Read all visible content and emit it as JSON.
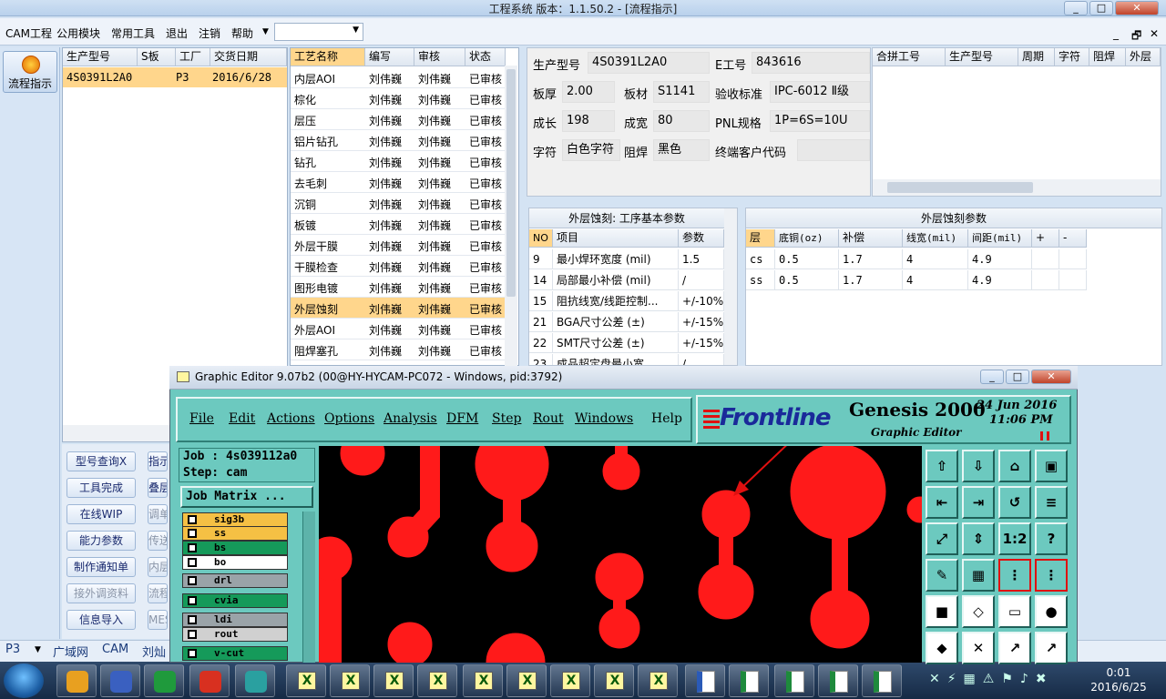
{
  "window": {
    "title": "工程系统  版本：1.1.50.2 - [流程指示]"
  },
  "menu": [
    "CAM工程",
    "公用模块",
    "常用工具",
    "退出",
    "注销",
    "帮助"
  ],
  "mdi_controls": [
    "_",
    "🗗",
    "✕"
  ],
  "sidebar": {
    "flow_button": "流程指示"
  },
  "job_grid": {
    "headers": [
      "生产型号",
      "S板",
      "工厂",
      "交货日期"
    ],
    "rows": [
      [
        "4S0391L2A0",
        "",
        "P3",
        "2016/6/28"
      ]
    ]
  },
  "process_grid": {
    "headers": [
      "工艺名称",
      "编写",
      "审核",
      "状态"
    ],
    "rows": [
      [
        "内层AOI",
        "刘伟巍",
        "刘伟巍",
        "已审核"
      ],
      [
        "棕化",
        "刘伟巍",
        "刘伟巍",
        "已审核"
      ],
      [
        "层压",
        "刘伟巍",
        "刘伟巍",
        "已审核"
      ],
      [
        "铝片钻孔",
        "刘伟巍",
        "刘伟巍",
        "已审核"
      ],
      [
        "钻孔",
        "刘伟巍",
        "刘伟巍",
        "已审核"
      ],
      [
        "去毛刺",
        "刘伟巍",
        "刘伟巍",
        "已审核"
      ],
      [
        "沉铜",
        "刘伟巍",
        "刘伟巍",
        "已审核"
      ],
      [
        "板镀",
        "刘伟巍",
        "刘伟巍",
        "已审核"
      ],
      [
        "外层干膜",
        "刘伟巍",
        "刘伟巍",
        "已审核"
      ],
      [
        "干膜检查",
        "刘伟巍",
        "刘伟巍",
        "已审核"
      ],
      [
        "图形电镀",
        "刘伟巍",
        "刘伟巍",
        "已审核"
      ],
      [
        "外层蚀刻",
        "刘伟巍",
        "刘伟巍",
        "已审核"
      ],
      [
        "外层AOI",
        "刘伟巍",
        "刘伟巍",
        "已审核"
      ],
      [
        "阻焊塞孔",
        "刘伟巍",
        "刘伟巍",
        "已审核"
      ]
    ],
    "selected": 11
  },
  "info": {
    "model_label": "生产型号",
    "model": "4S0391L2A0",
    "e_label": "E工号",
    "e_no": "843616",
    "thick_label": "板厚",
    "thick": "2.00",
    "mat_label": "板材",
    "mat": "S1141",
    "std_label": "验收标准",
    "std": "IPC-6012 Ⅱ级",
    "len_label": "成长",
    "len": "198",
    "wid_label": "成宽",
    "wid": "80",
    "pnl_label": "PNL规格",
    "pnl": "1P=6S=10U",
    "char_label": "字符",
    "char": "白色字符",
    "mask_label": "阻焊",
    "mask": "黑色",
    "cust_label": "终端客户代码",
    "cust": ""
  },
  "panel_grid": {
    "headers": [
      "合拼工号",
      "生产型号",
      "周期",
      "字符",
      "阻焊",
      "外层"
    ]
  },
  "params": {
    "title": "外层蚀刻: 工序基本参数",
    "headers": [
      "NO",
      "项目",
      "参数"
    ],
    "rows": [
      [
        "9",
        "最小焊环宽度 (mil)",
        "1.5"
      ],
      [
        "14",
        "局部最小补偿 (mil)",
        "/"
      ],
      [
        "15",
        "阻抗线宽/线距控制...",
        "+/-10%"
      ],
      [
        "21",
        "BGA尺寸公差 (±)",
        "+/-15%"
      ],
      [
        "22",
        "SMT尺寸公差 (±)",
        "+/-15%"
      ],
      [
        "23",
        "成品超定盘最小宽...",
        "/"
      ]
    ]
  },
  "layers": {
    "title": "外层蚀刻参数",
    "headers": [
      "层",
      "底铜(oz)",
      "补偿",
      "线宽(mil)",
      "间距(mil)",
      "+",
      "-"
    ],
    "rows": [
      [
        "cs",
        "0.5",
        "1.7",
        "4",
        "4.9"
      ],
      [
        "ss",
        "0.5",
        "1.7",
        "4",
        "4.9"
      ]
    ]
  },
  "func_buttons": [
    [
      "型号查询X",
      "指示"
    ],
    [
      "工具完成",
      "叠层"
    ],
    [
      "在线WIP",
      "调单"
    ],
    [
      "能力参数",
      "传送"
    ],
    [
      "制作通知单",
      "内层"
    ],
    [
      "接外调资料",
      "流程"
    ],
    [
      "信息导入",
      "MES"
    ]
  ],
  "status": {
    "factory": "P3",
    "net": "广域网",
    "mode": "CAM",
    "user": "刘灿"
  },
  "clock": {
    "time": "0:01",
    "date": "2016/6/25"
  },
  "ge": {
    "title": "Graphic Editor 9.07b2 (00@HY-HYCAM-PC072 - Windows, pid:3792)",
    "menus": [
      "File",
      "Edit",
      "Actions",
      "Options",
      "Analysis",
      "DFM",
      "Step",
      "Rout",
      "Windows",
      "Help"
    ],
    "brand": "Frontline",
    "product": "Genesis 2000",
    "subtitle": "Graphic Editor",
    "date": "24  Jun  2016",
    "time": "11:06  PM",
    "job_label": "Job : 4s039112a0",
    "step_label": "Step: cam",
    "matrix_btn": "Job Matrix ...",
    "layers": [
      {
        "name": "sig3b",
        "color": "#f5c044"
      },
      {
        "name": "ss",
        "color": "#f5c044"
      },
      {
        "name": "bs",
        "color": "#159a5a"
      },
      {
        "name": "bo",
        "color": "#ffffff"
      },
      {
        "name": "drl",
        "color": "#9aa3a8"
      },
      {
        "name": "cvia",
        "color": "#159a5a"
      },
      {
        "name": "ldi",
        "color": "#9aa3a8"
      },
      {
        "name": "rout",
        "color": "#d0d0d0"
      },
      {
        "name": "v-cut",
        "color": "#159a5a"
      }
    ]
  }
}
